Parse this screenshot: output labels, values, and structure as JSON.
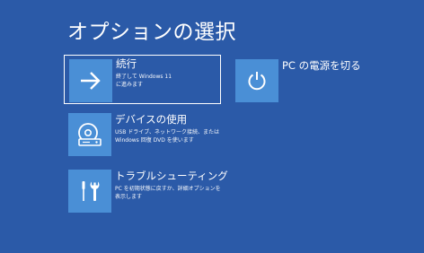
{
  "title": "オプションの選択",
  "options": {
    "continue": {
      "label": "続行",
      "description": "終了して Windows 11\nに進みます",
      "icon": "arrow-right-icon"
    },
    "use_device": {
      "label": "デバイスの使用",
      "description": "USB ドライブ、ネットワーク接続、または\nWindows 回復 DVD を使います",
      "icon": "disc-drive-icon"
    },
    "troubleshoot": {
      "label": "トラブルシューティング",
      "description": "PC を初期状態に戻すか、詳細オプションを\n表示します",
      "icon": "tools-icon"
    },
    "shutdown": {
      "label": "PC の電源を切る",
      "icon": "power-icon"
    }
  },
  "colors": {
    "background": "#2b5aa8",
    "tile": "#4a8fd6",
    "text": "#ffffff"
  }
}
